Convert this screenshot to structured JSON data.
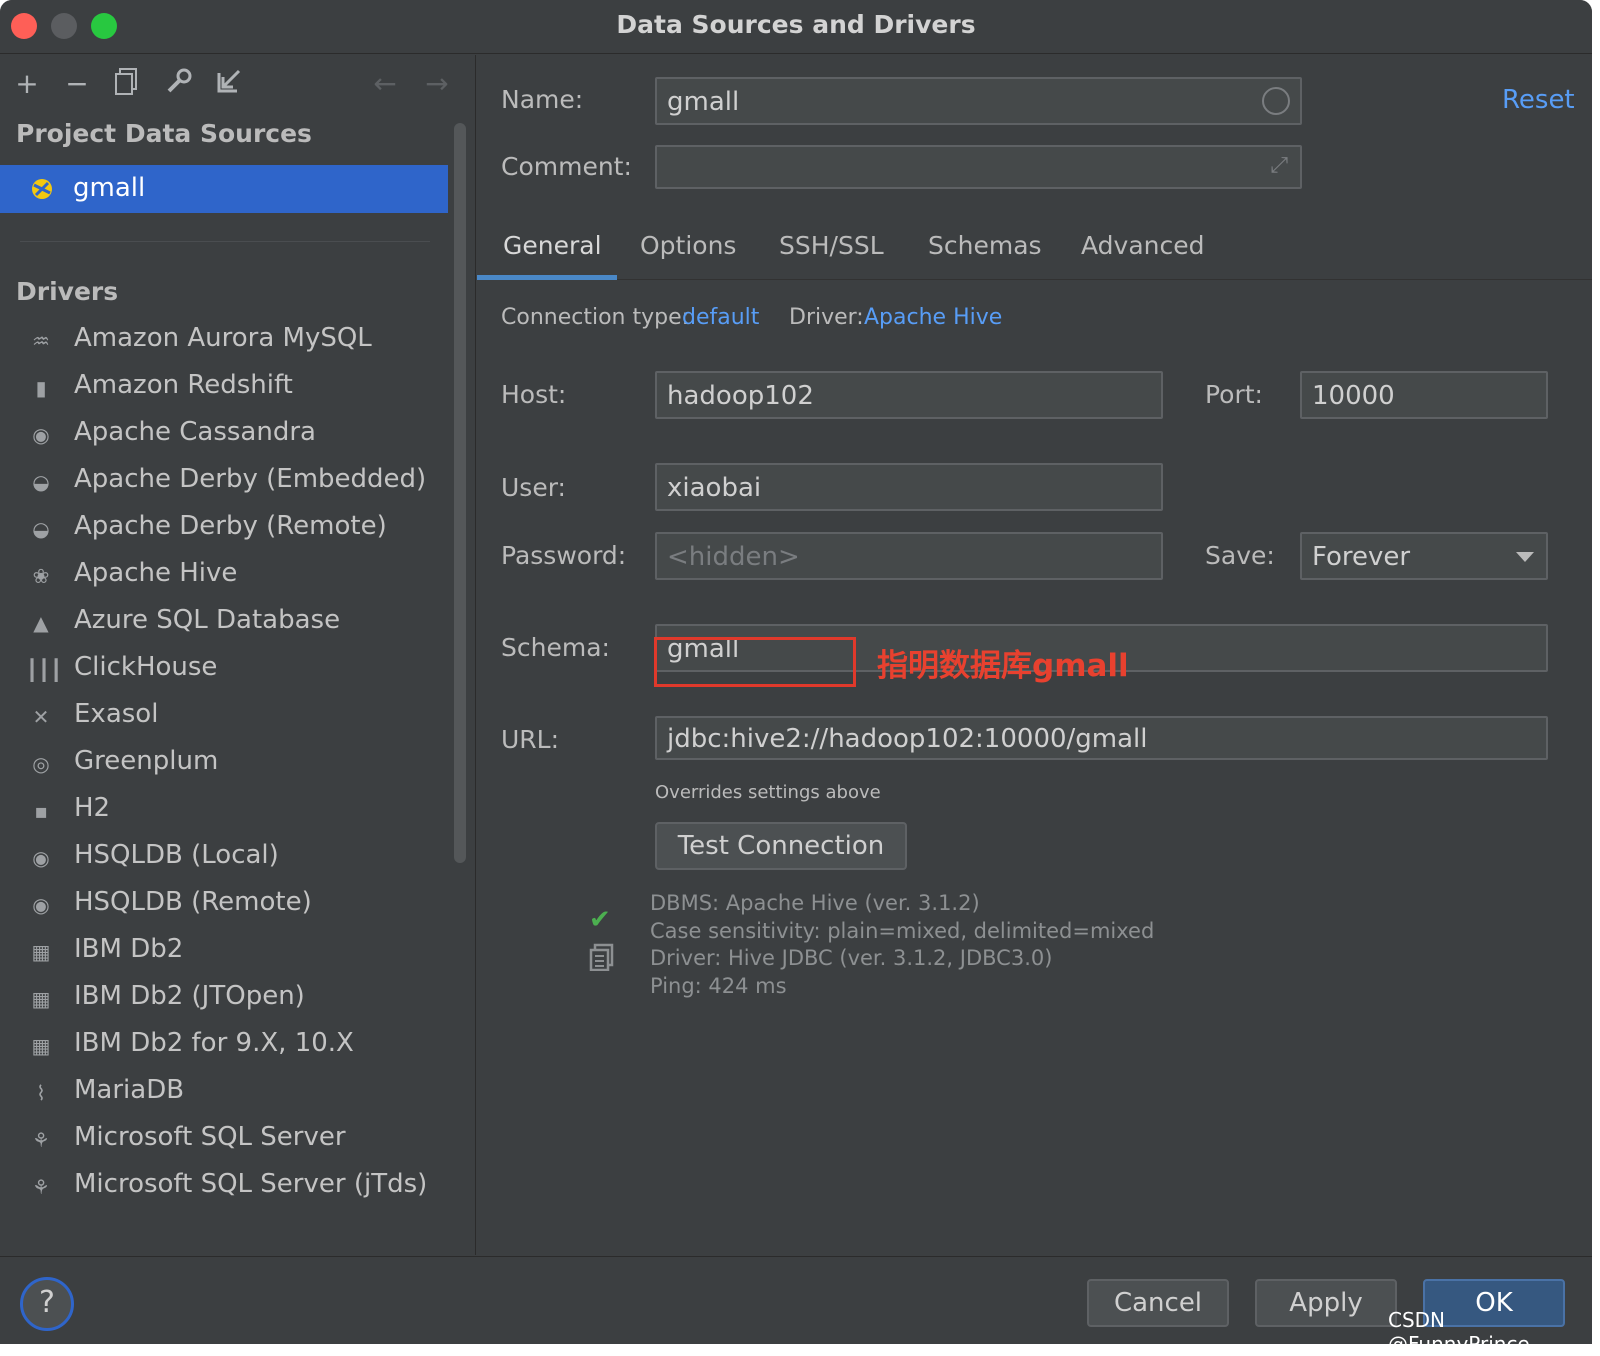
{
  "window": {
    "title": "Data Sources and Drivers"
  },
  "sidebar": {
    "project_title": "Project Data Sources",
    "selected_source": "gmall",
    "drivers_title": "Drivers",
    "drivers": [
      {
        "label": "Amazon Aurora MySQL",
        "icon": "dolphin-icon"
      },
      {
        "label": "Amazon Redshift",
        "icon": "redshift-icon"
      },
      {
        "label": "Apache Cassandra",
        "icon": "eye-icon"
      },
      {
        "label": "Apache Derby (Embedded)",
        "icon": "derby-icon"
      },
      {
        "label": "Apache Derby (Remote)",
        "icon": "derby-icon"
      },
      {
        "label": "Apache Hive",
        "icon": "hive-icon"
      },
      {
        "label": "Azure SQL Database",
        "icon": "azure-icon"
      },
      {
        "label": "ClickHouse",
        "icon": "clickhouse-icon"
      },
      {
        "label": "Exasol",
        "icon": "exasol-icon"
      },
      {
        "label": "Greenplum",
        "icon": "greenplum-icon"
      },
      {
        "label": "H2",
        "icon": "h2-icon"
      },
      {
        "label": "HSQLDB (Local)",
        "icon": "hsqldb-icon"
      },
      {
        "label": "HSQLDB (Remote)",
        "icon": "hsqldb-icon"
      },
      {
        "label": "IBM Db2",
        "icon": "ibm-db2-icon"
      },
      {
        "label": "IBM Db2 (JTOpen)",
        "icon": "ibm-db2-icon"
      },
      {
        "label": "IBM Db2 for 9.X, 10.X",
        "icon": "ibm-db2-icon"
      },
      {
        "label": "MariaDB",
        "icon": "mariadb-icon"
      },
      {
        "label": "Microsoft SQL Server",
        "icon": "mssql-icon"
      },
      {
        "label": "Microsoft SQL Server (jTds)",
        "icon": "mssql-icon"
      }
    ]
  },
  "form": {
    "name_label": "Name:",
    "name_value": "gmall",
    "comment_label": "Comment:",
    "comment_value": "",
    "reset_label": "Reset",
    "tabs": [
      "General",
      "Options",
      "SSH/SSL",
      "Schemas",
      "Advanced"
    ],
    "active_tab": "General",
    "connection_type_label": "Connection type:",
    "connection_type_value": "default",
    "driver_label": "Driver:",
    "driver_value": "Apache Hive",
    "host_label": "Host:",
    "host_value": "hadoop102",
    "port_label": "Port:",
    "port_value": "10000",
    "user_label": "User:",
    "user_value": "xiaobai",
    "password_label": "Password:",
    "password_placeholder": "<hidden>",
    "save_label": "Save:",
    "save_value": "Forever",
    "schema_label": "Schema:",
    "schema_value": "gmall",
    "schema_annotation": "指明数据库gmall",
    "url_label": "URL:",
    "url_value": "jdbc:hive2://hadoop102:10000/gmall",
    "url_hint": "Overrides settings above",
    "test_button": "Test Connection",
    "result_lines": [
      "DBMS: Apache Hive (ver. 3.1.2)",
      "Case sensitivity: plain=mixed, delimited=mixed",
      "Driver: Hive JDBC (ver. 3.1.2, JDBC3.0)",
      "Ping: 424 ms"
    ]
  },
  "footer": {
    "help": "?",
    "cancel": "Cancel",
    "apply": "Apply",
    "ok": "OK",
    "watermark": "CSDN @FunnyPrince_"
  },
  "colors": {
    "selection": "#2f65ca",
    "link": "#589df6",
    "annotation": "#e8412f",
    "success": "#4caf50"
  }
}
